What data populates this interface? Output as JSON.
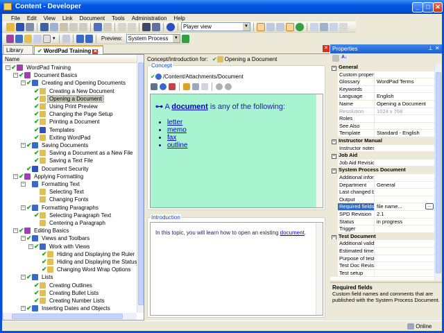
{
  "window": {
    "title": "Content - Developer"
  },
  "menu": [
    "File",
    "Edit",
    "View",
    "Link",
    "Document",
    "Tools",
    "Administration",
    "Help"
  ],
  "toolbar": {
    "view_combo": "Player view",
    "preview_label": "Preview:",
    "preview_combo": "System Process"
  },
  "tabs": {
    "library": "Library",
    "active": "WordPad Training"
  },
  "tree": {
    "header": "Name",
    "items": [
      {
        "label": "WordPad Training",
        "level": 0,
        "type": "book",
        "check": true,
        "exp": "-"
      },
      {
        "label": "Document Basics",
        "level": 1,
        "type": "book",
        "check": true,
        "exp": "-"
      },
      {
        "label": "Creating and Opening Documents",
        "level": 2,
        "type": "chapter",
        "check": true,
        "exp": "-"
      },
      {
        "label": "Creating a New Document",
        "level": 3,
        "type": "topic",
        "check": true
      },
      {
        "label": "Opening a Document",
        "level": 3,
        "type": "topic",
        "check": true,
        "selected": true
      },
      {
        "label": "Using Print Preview",
        "level": 3,
        "type": "topic",
        "check": true
      },
      {
        "label": "Changing the Page Setup",
        "level": 3,
        "type": "topic",
        "check": true
      },
      {
        "label": "Printing a Document",
        "level": 3,
        "type": "topic",
        "check": true
      },
      {
        "label": "Templates",
        "level": 3,
        "type": "doc",
        "check": true
      },
      {
        "label": "Exiting WordPad",
        "level": 3,
        "type": "topic",
        "check": true
      },
      {
        "label": "Saving Documents",
        "level": 2,
        "type": "chapter",
        "check": true,
        "exp": "-"
      },
      {
        "label": "Saving a Document as a New File",
        "level": 3,
        "type": "topic",
        "check": true
      },
      {
        "label": "Saving a Text File",
        "level": 3,
        "type": "topic",
        "check": true
      },
      {
        "label": "Document Security",
        "level": 2,
        "type": "doc",
        "check": true
      },
      {
        "label": "Applying Formatting",
        "level": 1,
        "type": "book",
        "check": true,
        "exp": "-"
      },
      {
        "label": "Formatting Text",
        "level": 2,
        "type": "chapter",
        "check": false,
        "exp": "-"
      },
      {
        "label": "Selecting Text",
        "level": 3,
        "type": "topic",
        "check": false
      },
      {
        "label": "Changing Fonts",
        "level": 3,
        "type": "topic",
        "check": false
      },
      {
        "label": "Formatting Paragraphs",
        "level": 2,
        "type": "chapter",
        "check": true,
        "exp": "-"
      },
      {
        "label": "Selecting Paragraph Text",
        "level": 3,
        "type": "topic",
        "check": true
      },
      {
        "label": "Centering a Paragraph",
        "level": 3,
        "type": "topic",
        "check": false
      },
      {
        "label": "Editing Basics",
        "level": 1,
        "type": "book",
        "check": true,
        "exp": "-"
      },
      {
        "label": "Views and Toolbars",
        "level": 2,
        "type": "chapter",
        "check": true,
        "exp": "-"
      },
      {
        "label": "Work with Views",
        "level": 3,
        "type": "chapter",
        "check": true,
        "exp": "-"
      },
      {
        "label": "Hiding and Displaying the Ruler",
        "level": 4,
        "type": "topic",
        "check": true
      },
      {
        "label": "Hiding and Displaying the Status Bar",
        "level": 4,
        "type": "topic",
        "check": true
      },
      {
        "label": "Changing Word Wrap Options",
        "level": 4,
        "type": "topic",
        "check": true
      },
      {
        "label": "Lists",
        "level": 2,
        "type": "chapter",
        "check": true,
        "exp": "-"
      },
      {
        "label": "Creating Outlines",
        "level": 3,
        "type": "topic",
        "check": true
      },
      {
        "label": "Creating Bullet Lists",
        "level": 3,
        "type": "topic",
        "check": true
      },
      {
        "label": "Creating Number Lists",
        "level": 3,
        "type": "topic",
        "check": true
      },
      {
        "label": "Inserting Dates and Objects",
        "level": 2,
        "type": "chapter",
        "check": true,
        "exp": "-"
      }
    ]
  },
  "editor": {
    "header_label": "Concept/Introduction for:",
    "header_topic": "Opening a Document",
    "concept_label": "Concept",
    "path": "/Content/Attachments/Document",
    "concept": {
      "pre": "A ",
      "link": "document",
      "post": " is any of the following:",
      "bullets": [
        "letter",
        "memo",
        "fax",
        "outline"
      ]
    },
    "intro_label": "Introduction",
    "intro": {
      "pre": "In this topic, you will learn how to open an existing ",
      "link": "document",
      "post": "."
    }
  },
  "properties": {
    "title": "Properties",
    "rows": [
      {
        "cat": "General"
      },
      {
        "n": "Custom properties",
        "v": ""
      },
      {
        "n": "Glossary",
        "v": "WordPad Terms"
      },
      {
        "n": "Keywords",
        "v": ""
      },
      {
        "n": "Language",
        "v": "English"
      },
      {
        "n": "Name",
        "v": "Opening a Document"
      },
      {
        "n": "Resolution",
        "v": "1024 x 768",
        "dis": true
      },
      {
        "n": "Roles",
        "v": ""
      },
      {
        "n": "See Also",
        "v": ""
      },
      {
        "n": "Template",
        "v": "Standard - English"
      },
      {
        "cat": "Instructor Manual"
      },
      {
        "n": "Instructor notes",
        "v": ""
      },
      {
        "cat": "Job Aid"
      },
      {
        "n": "Job Aid Revision",
        "v": ""
      },
      {
        "cat": "System Process Document"
      },
      {
        "n": "Additional infor...",
        "v": ""
      },
      {
        "n": "Department",
        "v": "General"
      },
      {
        "n": "Last changed by",
        "v": ""
      },
      {
        "n": "Output",
        "v": ""
      },
      {
        "n": "Required fields",
        "v": "file name...",
        "sel": true
      },
      {
        "n": "SPD Revision",
        "v": "2.1"
      },
      {
        "n": "Status",
        "v": "in progress"
      },
      {
        "n": "Trigger",
        "v": ""
      },
      {
        "cat": "Test Document"
      },
      {
        "n": "Additional valida...",
        "v": ""
      },
      {
        "n": "Estimated time",
        "v": ""
      },
      {
        "n": "Purpose of test",
        "v": ""
      },
      {
        "n": "Test Doc Revision",
        "v": ""
      },
      {
        "n": "Test setup",
        "v": ""
      }
    ],
    "desc_title": "Required fields",
    "desc_text": "Custom field names and comments that are published with the System Process Document.",
    "ellipsis": "..."
  },
  "status": {
    "online": "Online"
  }
}
